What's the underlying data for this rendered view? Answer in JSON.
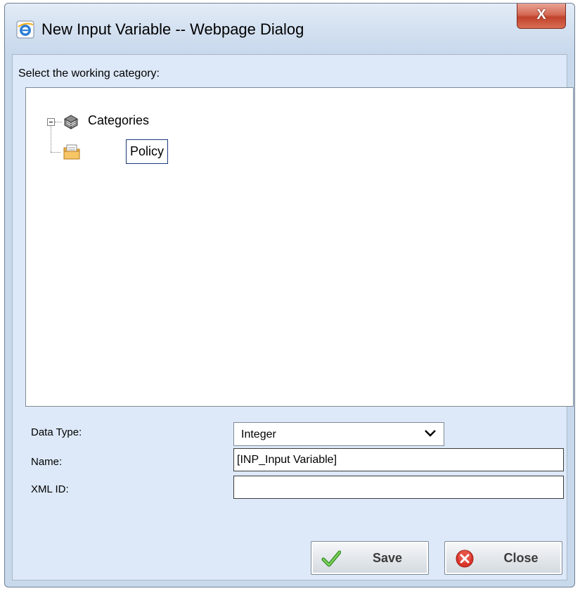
{
  "window": {
    "title": "New Input Variable -- Webpage Dialog",
    "close_glyph": "X"
  },
  "tree_section": {
    "label": "Select the working category:",
    "root": {
      "label": "Categories",
      "icon": "categories-icon",
      "expanded": true
    },
    "children": [
      {
        "label": "Policy",
        "icon": "policy-folder-icon",
        "selected": true
      }
    ]
  },
  "form": {
    "data_type": {
      "label": "Data Type:",
      "value": "Integer"
    },
    "name": {
      "label": "Name:",
      "value": "[INP_Input Variable]"
    },
    "xml_id": {
      "label": "XML ID:",
      "value": ""
    }
  },
  "buttons": {
    "save": {
      "label": "Save",
      "icon": "checkmark-icon"
    },
    "close": {
      "label": "Close",
      "icon": "close-circle-icon"
    }
  },
  "colors": {
    "dialog_bg": "#dde9f8",
    "close_x_bg": "#c1432c",
    "selection_border": "#1a3a7a",
    "save_icon": "#3fae2a",
    "close_icon": "#d9342a"
  }
}
